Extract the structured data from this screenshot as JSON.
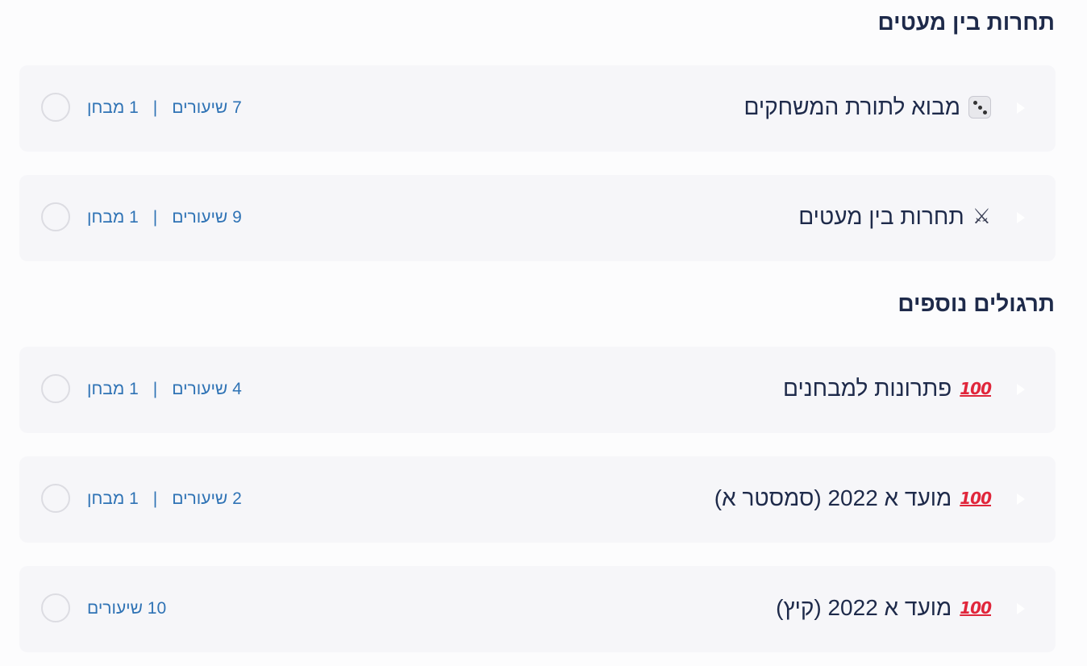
{
  "sections": [
    {
      "title": "תחרות בין מעטים",
      "items": [
        {
          "icon": "game-die-icon",
          "title": "מבוא לתורת המשחקים",
          "lessons": "7 שיעורים",
          "separator": "|",
          "exams": "1 מבחן"
        },
        {
          "icon": "crossed-swords-icon",
          "title": "תחרות בין מעטים",
          "lessons": "9 שיעורים",
          "separator": "|",
          "exams": "1 מבחן"
        }
      ]
    },
    {
      "title": "תרגולים נוספים",
      "items": [
        {
          "icon": "hundred-points-icon",
          "title": "פתרונות למבחנים",
          "lessons": "4 שיעורים",
          "separator": "|",
          "exams": "1 מבחן"
        },
        {
          "icon": "hundred-points-icon",
          "title": "מועד א 2022 (סמסטר א)",
          "lessons": "2 שיעורים",
          "separator": "|",
          "exams": "1 מבחן"
        },
        {
          "icon": "hundred-points-icon",
          "title": "מועד א 2022 (קיץ)",
          "lessons": "10 שיעורים"
        }
      ]
    }
  ],
  "icons": {
    "swords_glyph": "⚔",
    "hundred_glyph": "100"
  },
  "colors": {
    "heading": "#1e2a4a",
    "meta_link": "#2f73b5",
    "row_bg": "#f6f6f9",
    "hundred_red": "#e0263b"
  }
}
